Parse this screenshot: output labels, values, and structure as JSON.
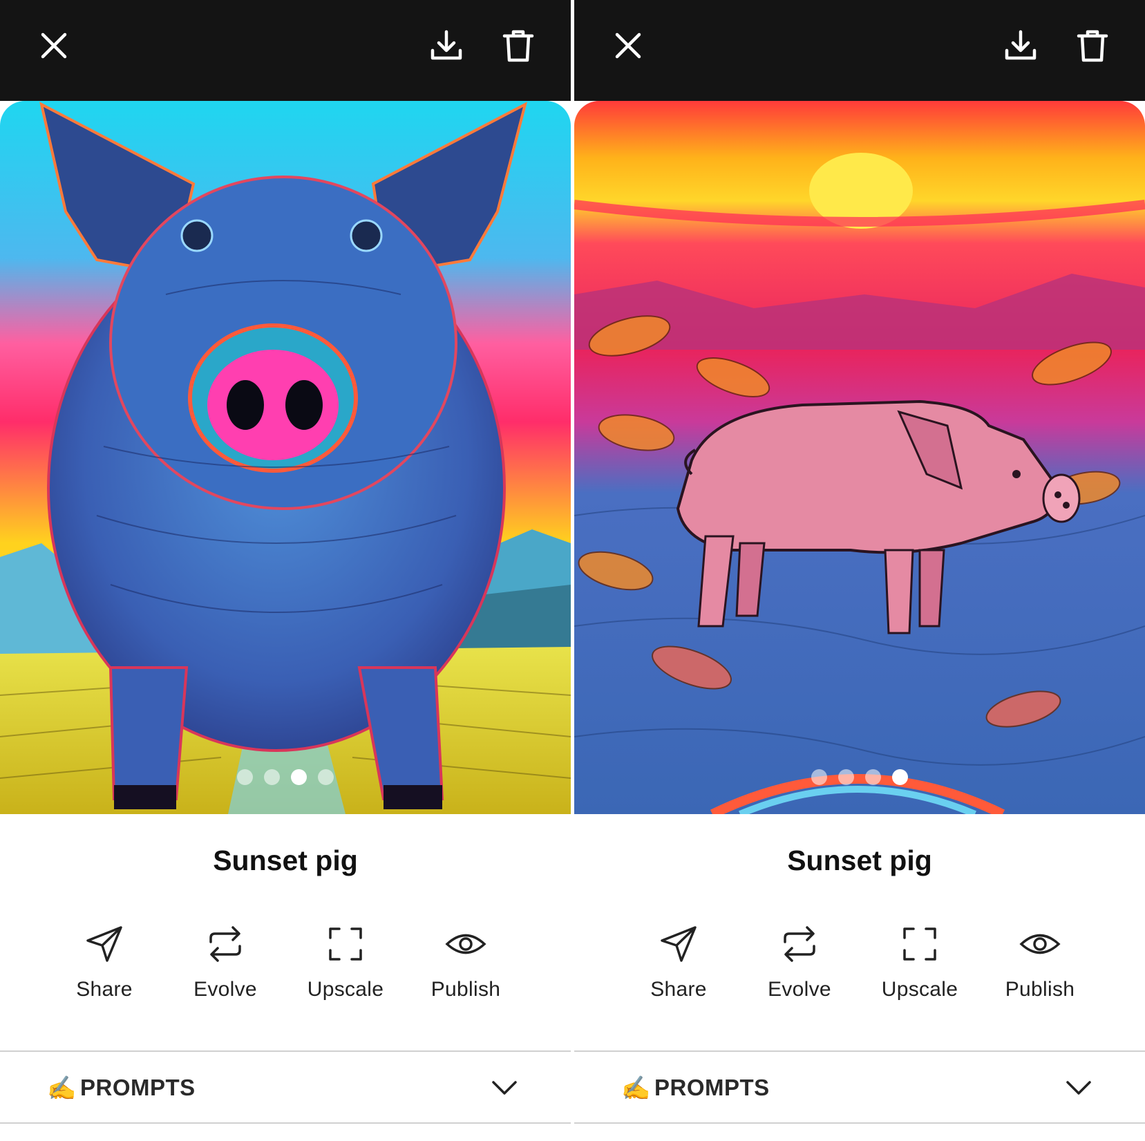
{
  "panels": [
    {
      "title": "Sunset pig",
      "image": "blue-pig-front-sunset-artwork",
      "carousel": {
        "count": 4,
        "active_index": 2
      },
      "actions": [
        {
          "label": "Share",
          "icon": "send-icon"
        },
        {
          "label": "Evolve",
          "icon": "repeat-icon"
        },
        {
          "label": "Upscale",
          "icon": "expand-icon"
        },
        {
          "label": "Publish",
          "icon": "eye-icon"
        }
      ],
      "prompts": {
        "emoji": "✍️",
        "label": "PROMPTS"
      }
    },
    {
      "title": "Sunset pig",
      "image": "pink-pig-side-sunset-artwork",
      "carousel": {
        "count": 4,
        "active_index": 3
      },
      "actions": [
        {
          "label": "Share",
          "icon": "send-icon"
        },
        {
          "label": "Evolve",
          "icon": "repeat-icon"
        },
        {
          "label": "Upscale",
          "icon": "expand-icon"
        },
        {
          "label": "Publish",
          "icon": "eye-icon"
        }
      ],
      "prompts": {
        "emoji": "✍️",
        "label": "PROMPTS"
      }
    }
  ],
  "topbar_icons": [
    "close-icon",
    "download-icon",
    "trash-icon"
  ],
  "colors": {
    "topbar": "#141414",
    "text": "#111111",
    "divider": "#d0d0d0"
  }
}
